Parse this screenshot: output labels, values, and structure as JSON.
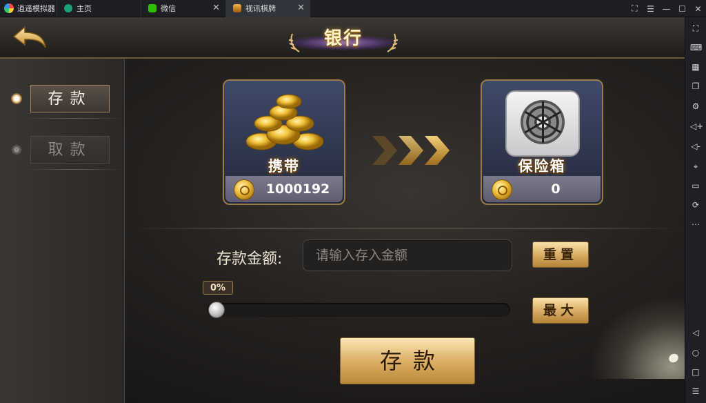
{
  "titlebar": {
    "app_name": "逍遥模拟器",
    "tabs": [
      {
        "label": "主页",
        "icon": "home-tab-icon"
      },
      {
        "label": "微信",
        "icon": "wechat-tab-icon"
      },
      {
        "label": "视讯棋牌",
        "icon": "game-tab-icon"
      }
    ],
    "close_glyph": "✕",
    "window_controls": [
      "⛶",
      "☰",
      "—",
      "☐",
      "✕"
    ]
  },
  "sidebar": {
    "buttons": [
      "fullscreen",
      "keyboard",
      "apk-install",
      "multi-window",
      "settings",
      "volume-up",
      "volume-down",
      "location",
      "folder",
      "rotate",
      "more"
    ],
    "glyphs": [
      "⛶",
      "⌨",
      "▦",
      "❐",
      "⚙",
      "◁+",
      "◁-",
      "⌖",
      "▭",
      "⟳",
      "⋯"
    ],
    "nav": [
      "◁",
      "○",
      "□",
      "☰"
    ]
  },
  "game": {
    "title": "银行",
    "menu": [
      {
        "label": "存款",
        "active": true
      },
      {
        "label": "取款",
        "active": false
      }
    ],
    "carry": {
      "label": "携带",
      "value": "1000192"
    },
    "safe": {
      "label": "保险箱",
      "value": "0"
    },
    "form": {
      "amount_label": "存款金额:",
      "amount_placeholder": "请输入存入金额",
      "reset_label": "重置",
      "max_label": "最大",
      "percent_text": "0%",
      "percent_value": 0,
      "submit_label": "存款"
    },
    "colors": {
      "gold": "#d7a961",
      "panel_border": "#9c7a48",
      "text_light": "#ece3d3"
    }
  }
}
